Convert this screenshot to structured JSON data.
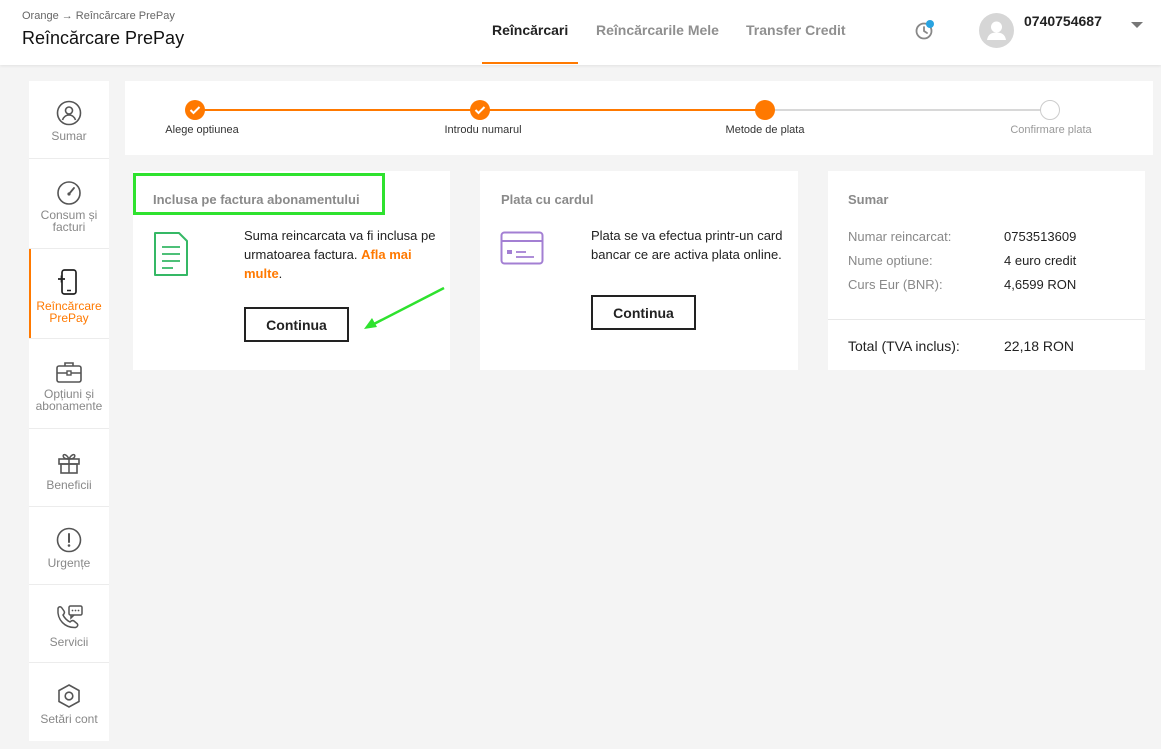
{
  "header": {
    "breadcrumb": "Orange → Reîncărcare PrePay",
    "title": "Reîncărcare PrePay",
    "tabs": [
      {
        "label": "Reîncărcari",
        "active": true
      },
      {
        "label": "Reîncărcarile Mele",
        "active": false
      },
      {
        "label": "Transfer Credit",
        "active": false
      }
    ],
    "phone_number": "0740754687",
    "icons": {
      "history": "clock-icon",
      "avatar": "user-avatar-icon",
      "menu": "caret-down-icon"
    }
  },
  "sidebar": {
    "items": [
      {
        "label": "Sumar",
        "icon": "user-circle-icon",
        "active": false
      },
      {
        "label": "Consum și facturi",
        "icon": "gauge-icon",
        "active": false
      },
      {
        "label": "Reîncărcare PrePay",
        "icon": "phone-plus-icon",
        "active": true
      },
      {
        "label": "Opțiuni și abonamente",
        "icon": "briefcase-icon",
        "active": false
      },
      {
        "label": "Beneficii",
        "icon": "gift-icon",
        "active": false
      },
      {
        "label": "Urgențe",
        "icon": "alert-icon",
        "active": false
      },
      {
        "label": "Servicii",
        "icon": "phone-chat-icon",
        "active": false
      },
      {
        "label": "Setări cont",
        "icon": "hexagon-settings-icon",
        "active": false
      }
    ]
  },
  "stepper": {
    "steps": [
      {
        "label": "Alege optiunea",
        "state": "done"
      },
      {
        "label": "Introdu numarul",
        "state": "done"
      },
      {
        "label": "Metode de plata",
        "state": "current"
      },
      {
        "label": "Confirmare plata",
        "state": "todo"
      }
    ]
  },
  "cards": {
    "invoice": {
      "title": "Inclusa pe factura abonamentului",
      "text": "Suma reincarcata va fi inclusa pe urmatoarea factura. ",
      "link": "Afla mai multe",
      "text_end": ".",
      "button": "Continua",
      "icon": "invoice-document-icon"
    },
    "card": {
      "title": "Plata cu cardul",
      "text": "Plata se va efectua printr-un card bancar ce are activa plata online.",
      "button": "Continua",
      "icon": "credit-card-icon"
    },
    "summary": {
      "title": "Sumar",
      "rows": [
        {
          "label": "Numar reincarcat:",
          "value": "0753513609"
        },
        {
          "label": "Nume optiune:",
          "value": "4 euro credit"
        },
        {
          "label": "Curs Eur (BNR):",
          "value": "4,6599 RON"
        }
      ],
      "total_label": "Total (TVA inclus):",
      "total_value": "22,18 RON"
    }
  },
  "colors": {
    "accent": "#ff7900",
    "highlight": "#2ee22e",
    "invoice_icon": "#35b865",
    "card_icon": "#a37fd3"
  }
}
